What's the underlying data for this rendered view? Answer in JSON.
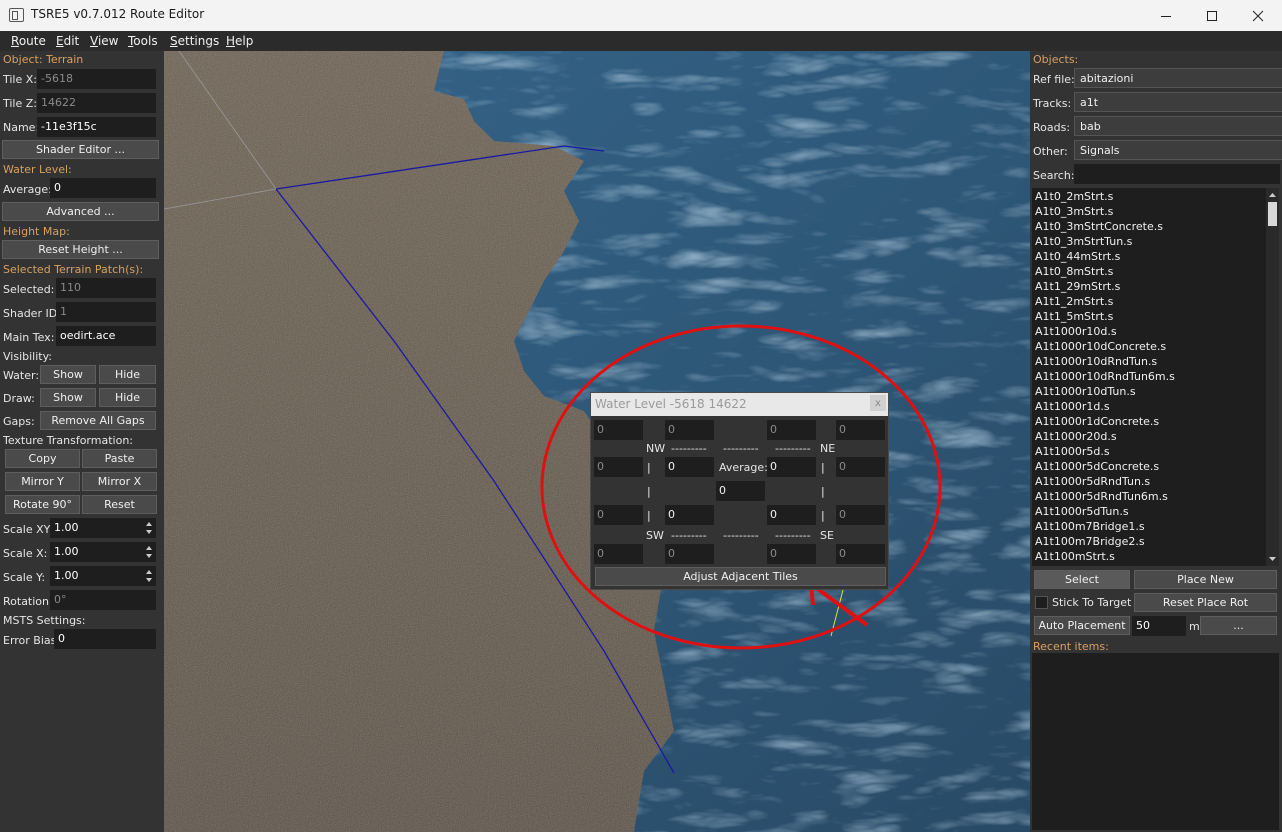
{
  "window": {
    "title": "TSRE5 v0.7.012 Route Editor",
    "minimize_icon": "minimize-icon",
    "maximize_icon": "maximize-icon",
    "close_icon": "close-icon"
  },
  "menu": {
    "items": [
      {
        "label": "Route",
        "accel": "R"
      },
      {
        "label": "Edit",
        "accel": "E"
      },
      {
        "label": "View",
        "accel": "V"
      },
      {
        "label": "Tools",
        "accel": "T"
      },
      {
        "label": "Settings",
        "accel": "S"
      },
      {
        "label": "Help",
        "accel": "H"
      }
    ]
  },
  "left": {
    "object_section": "Object: Terrain",
    "tile_x_label": "Tile X:",
    "tile_x_value": "-5618",
    "tile_z_label": "Tile Z:",
    "tile_z_value": "14622",
    "name_label": "Name:",
    "name_value": "-11e3f15c",
    "shader_editor_btn": "Shader Editor ...",
    "water_section": "Water Level:",
    "average_label": "Average:",
    "average_value": "0",
    "advanced_btn": "Advanced ...",
    "height_section": "Height Map:",
    "reset_height_btn": "Reset Height ...",
    "patch_section": "Selected Terrain Patch(s):",
    "selected_label": "Selected:",
    "selected_value": "110",
    "shader_id_label": "Shader ID:",
    "shader_id_value": "1",
    "main_tex_label": "Main Tex:",
    "main_tex_value": "oedirt.ace",
    "visibility_label": "Visibility:",
    "water_label": "Water:",
    "draw_label": "Draw:",
    "show_btn": "Show",
    "hide_btn": "Hide",
    "gaps_label": "Gaps:",
    "remove_gaps_btn": "Remove All Gaps",
    "texture_transform_label": "Texture Transformation:",
    "copy_btn": "Copy",
    "paste_btn": "Paste",
    "mirror_y_btn": "Mirror Y",
    "mirror_x_btn": "Mirror X",
    "rotate_btn": "Rotate 90°",
    "reset_btn": "Reset",
    "scale_xy_label": "Scale XY",
    "scale_xy_value": "1.00",
    "scale_x_label": "Scale X:",
    "scale_x_value": "1.00",
    "scale_y_label": "Scale Y:",
    "scale_y_value": "1.00",
    "rotation_label": "Rotation:",
    "rotation_value": "0°",
    "msts_label": "MSTS Settings:",
    "error_bias_label": "Error Bias:",
    "error_bias_value": "0"
  },
  "dialog": {
    "title": "Water Level -5618 14622",
    "close_glyph": "x",
    "nw": "NW",
    "ne": "NE",
    "sw": "SW",
    "se": "SE",
    "dashes": "---------",
    "bar": "|",
    "average_label": "Average:",
    "row1": [
      "0",
      "0",
      "0",
      "0"
    ],
    "row2": [
      "0",
      "0",
      "0",
      "0"
    ],
    "center_value": "0",
    "row3": [
      "0",
      "0",
      "0",
      "0"
    ],
    "row4": [
      "0",
      "0",
      "0",
      "0"
    ],
    "adjust_btn": "Adjust Adjacent Tiles"
  },
  "right": {
    "objects_section": "Objects:",
    "ref_file_label": "Ref file:",
    "ref_file_value": "abitazioni",
    "tracks_label": "Tracks:",
    "tracks_value": "a1t",
    "roads_label": "Roads:",
    "roads_value": "bab",
    "other_label": "Other:",
    "other_value": "Signals",
    "search_label": "Search:",
    "search_value": "",
    "items": [
      "A1t0_2mStrt.s",
      "A1t0_3mStrt.s",
      "A1t0_3mStrtConcrete.s",
      "A1t0_3mStrtTun.s",
      "A1t0_44mStrt.s",
      "A1t0_8mStrt.s",
      "A1t1_29mStrt.s",
      "A1t1_2mStrt.s",
      "A1t1_5mStrt.s",
      "A1t1000r10d.s",
      "A1t1000r10dConcrete.s",
      "A1t1000r10dRndTun.s",
      "A1t1000r10dRndTun6m.s",
      "A1t1000r10dTun.s",
      "A1t1000r1d.s",
      "A1t1000r1dConcrete.s",
      "A1t1000r20d.s",
      "A1t1000r5d.s",
      "A1t1000r5dConcrete.s",
      "A1t1000r5dRndTun.s",
      "A1t1000r5dRndTun6m.s",
      "A1t1000r5dTun.s",
      "A1t100m7Bridge1.s",
      "A1t100m7Bridge2.s",
      "A1t100mStrt.s"
    ],
    "select_btn": "Select",
    "place_new_btn": "Place New",
    "stick_label": "Stick To Target",
    "reset_place_rot_btn": "Reset Place Rot",
    "auto_placement_btn": "Auto Placement",
    "auto_value": "50",
    "unit_m": "m",
    "more_btn": "...",
    "recent_section": "Recent items:"
  },
  "colors": {
    "accent_orange": "#d8a062",
    "annotation_red": "#e01010",
    "track_blue": "#1a1aa0",
    "water_blue": "#2f5a7e",
    "terrain_brown": "#5e5447"
  }
}
